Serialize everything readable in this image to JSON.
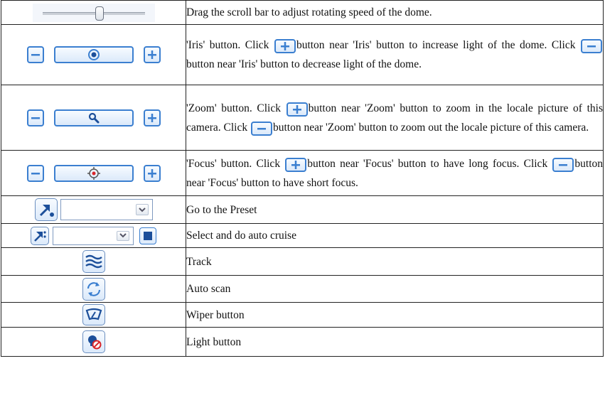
{
  "rows": [
    {
      "desc": "Drag the scroll bar to adjust rotating speed of the dome.",
      "speed_fraction": 0.5
    },
    {
      "desc_parts": [
        "'Iris' button. Click ",
        "button near 'Iris' button to increase light of the dome. Click ",
        "button near 'Iris' button to decrease light of the dome."
      ]
    },
    {
      "desc_parts": [
        "'Zoom' button. Click ",
        "button near 'Zoom' button to zoom in the locale picture of this camera. Click ",
        "button near 'Zoom' button to zoom out the locale picture of this camera."
      ]
    },
    {
      "desc_parts": [
        "'Focus' button. Click ",
        "button near 'Focus' button to have long focus. Click ",
        "button near 'Focus' button to have short focus."
      ]
    },
    {
      "desc": "Go to the Preset"
    },
    {
      "desc": "Select and do auto cruise"
    },
    {
      "desc": "Track"
    },
    {
      "desc": "Auto scan"
    },
    {
      "desc": "Wiper button"
    },
    {
      "desc": "Light button"
    }
  ],
  "icons": {
    "iris": "iris-icon",
    "zoom": "magnifier-icon",
    "focus": "focus-target-icon",
    "preset": "preset-arrow-icon",
    "cruise": "cruise-arrow-icon",
    "stop": "stop-icon",
    "track": "waves-icon",
    "scan": "refresh-icon",
    "wiper": "wiper-icon",
    "light": "light-off-icon"
  },
  "colors": {
    "accent": "#3b7fd0",
    "border": "#222222"
  }
}
